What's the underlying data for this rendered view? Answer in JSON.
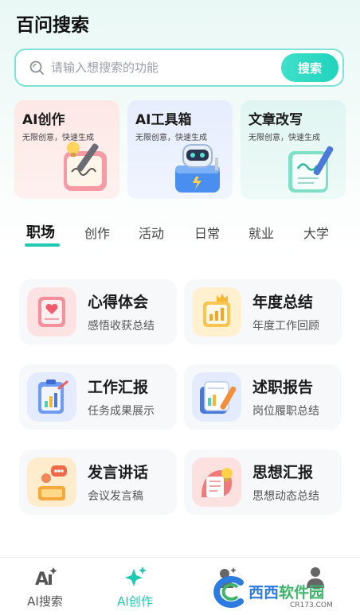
{
  "app": {
    "title": "百问搜索"
  },
  "search": {
    "placeholder": "请输入想搜索的功能",
    "button_label": "搜索"
  },
  "feature_cards": [
    {
      "title": "AI创作",
      "subtitle": "无限创意，快速生成",
      "icon": "writing-hand-icon"
    },
    {
      "title": "AI工具箱",
      "subtitle": "无限创意，快速生成",
      "icon": "robot-toolbox-icon"
    },
    {
      "title": "文章改写",
      "subtitle": "无限创意，快速生成",
      "icon": "document-pen-icon"
    }
  ],
  "tabs": [
    "职场",
    "创作",
    "活动",
    "日常",
    "就业",
    "大学"
  ],
  "active_tab": "职场",
  "tools": [
    {
      "title": "心得体会",
      "subtitle": "感悟收获总结",
      "icon": "heart-note-icon",
      "color": "#f7a5ad"
    },
    {
      "title": "年度总结",
      "subtitle": "年度工作回顾",
      "icon": "crown-chart-icon",
      "color": "#fbd27a"
    },
    {
      "title": "工作汇报",
      "subtitle": "任务成果展示",
      "icon": "bar-chart-board-icon",
      "color": "#93b5f5"
    },
    {
      "title": "述职报告",
      "subtitle": "岗位履职总结",
      "icon": "report-pen-icon",
      "color": "#93b5f5"
    },
    {
      "title": "发言讲话",
      "subtitle": "会议发言稿",
      "icon": "speech-podium-icon",
      "color": "#fbc57a"
    },
    {
      "title": "思想汇报",
      "subtitle": "思想动态总结",
      "icon": "idea-report-icon",
      "color": "#f5878f"
    }
  ],
  "bottom_nav": [
    {
      "label": "AI搜索",
      "icon": "ai-search-icon"
    },
    {
      "label": "AI创作",
      "icon": "sparkle-icon"
    },
    {
      "label": "",
      "icon": "user-sparkle-icon"
    },
    {
      "label": "",
      "icon": "profile-icon"
    }
  ],
  "active_nav": "AI创作",
  "watermark": {
    "text_a": "西西",
    "text_b": "软件园",
    "url": "CR173.COM"
  },
  "colors": {
    "accent": "#1fcab3",
    "search_border": "#7ee3d6",
    "text_dark": "#1b1b1b"
  }
}
